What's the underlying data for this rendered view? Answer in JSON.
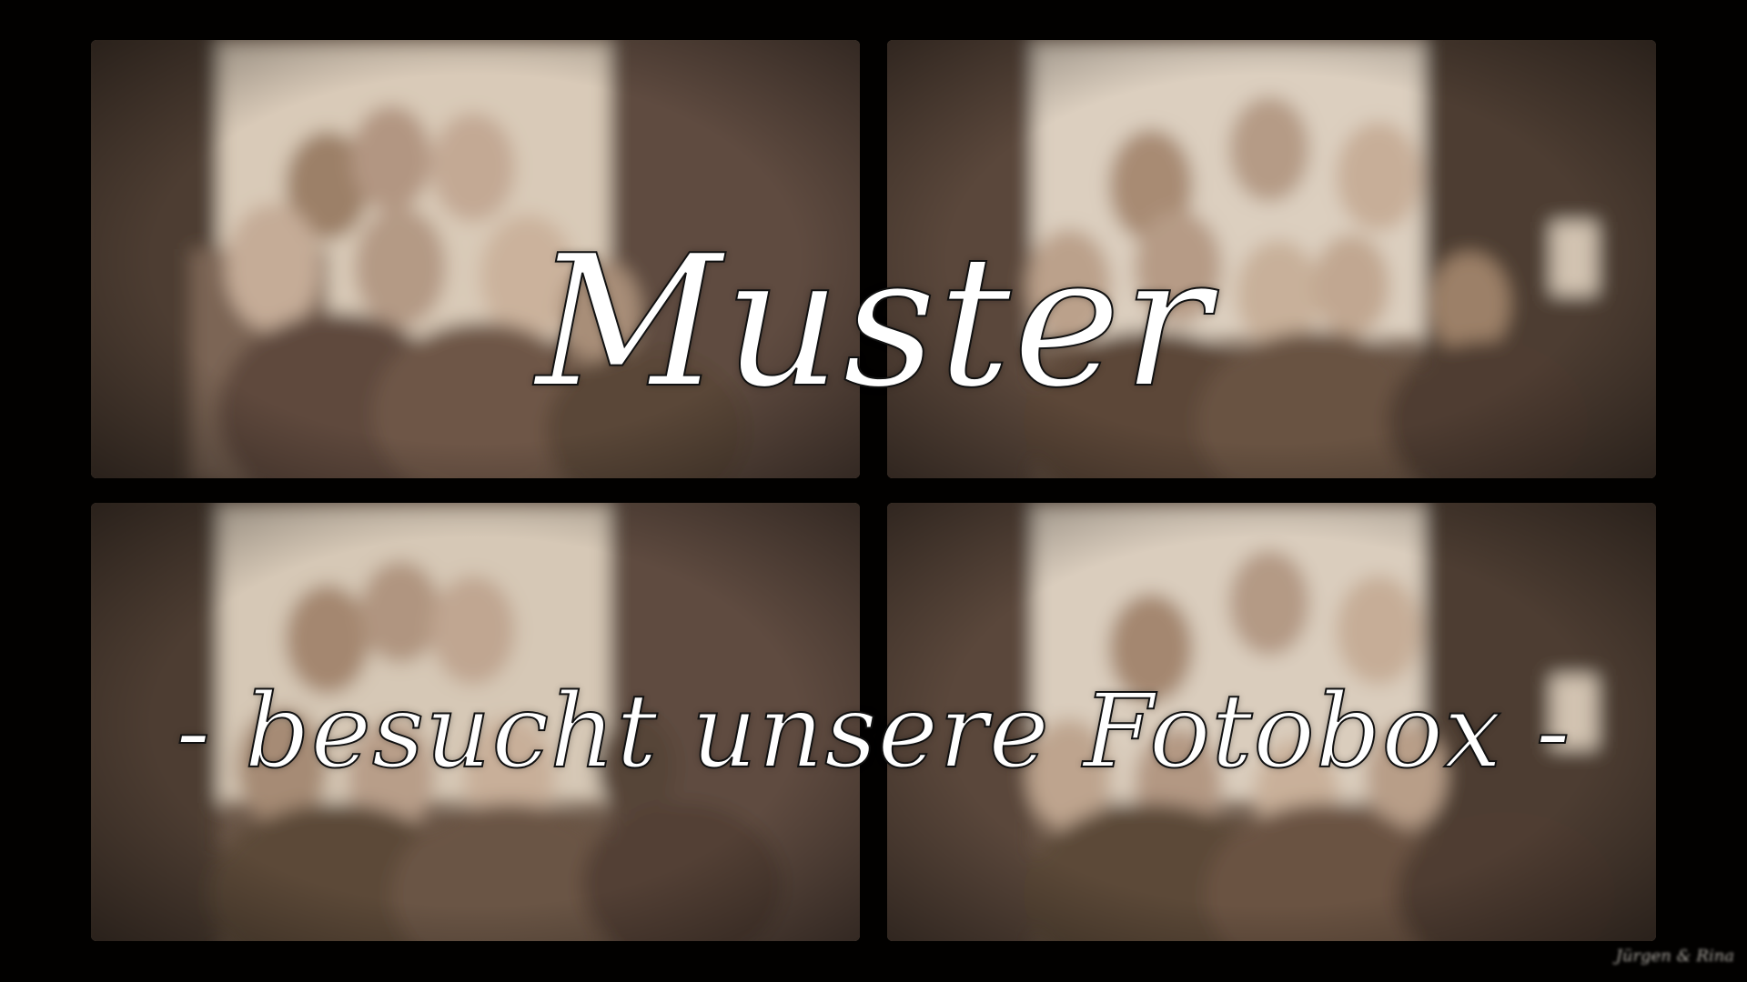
{
  "title": "Muster",
  "subtitle": "- besucht unsere Fotobox -",
  "watermark": "Jürgen & Rina",
  "colors": {
    "background": "#020100",
    "sepia_light": "#d8cbbc",
    "sepia_mid": "#a58d77",
    "sepia_dark": "#4a3a30",
    "text_fill": "#ffffff",
    "text_outline": "#111111"
  },
  "photos": [
    {
      "name": "photo-top-left"
    },
    {
      "name": "photo-top-right"
    },
    {
      "name": "photo-bottom-left"
    },
    {
      "name": "photo-bottom-right"
    }
  ]
}
